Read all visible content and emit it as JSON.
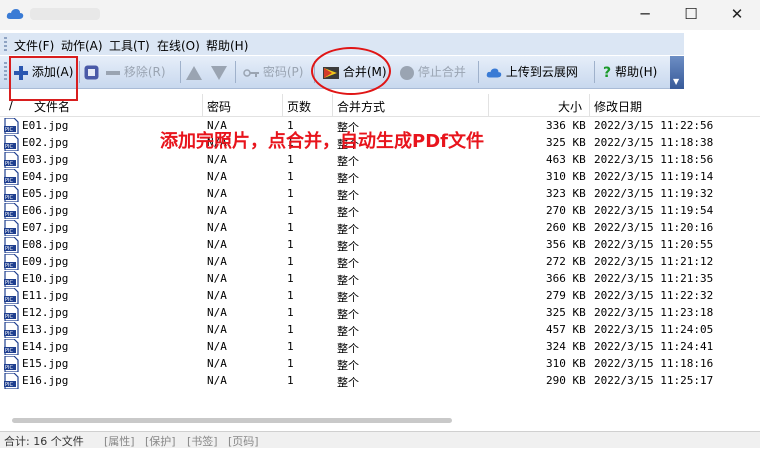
{
  "window": {
    "title": "",
    "minimize_glyph": "─",
    "maximize_glyph": "☐",
    "close_glyph": "✕"
  },
  "menu": [
    {
      "label": "文件(F)"
    },
    {
      "label": "动作(A)"
    },
    {
      "label": "工具(T)"
    },
    {
      "label": "在线(O)"
    },
    {
      "label": "帮助(H)"
    }
  ],
  "toolbar": {
    "add": "添加(A)",
    "remove": "移除(R)",
    "password": "密码(P)",
    "merge": "合并(M)",
    "stop_merge": "停止合并",
    "upload": "上传到云展网",
    "help": "帮助(H)",
    "overflow": "▼"
  },
  "columns": {
    "sort": "/",
    "name": "文件名",
    "password": "密码",
    "pages": "页数",
    "merge_mode": "合并方式",
    "size": "大小",
    "modified": "修改日期"
  },
  "files": [
    {
      "name": "E01.jpg",
      "password": "N/A",
      "pages": "1",
      "mode": "整个",
      "size": "336 KB",
      "date": "2022/3/15 11:22:56"
    },
    {
      "name": "E02.jpg",
      "password": "N/A",
      "pages": "1",
      "mode": "整个",
      "size": "325 KB",
      "date": "2022/3/15 11:18:38"
    },
    {
      "name": "E03.jpg",
      "password": "N/A",
      "pages": "1",
      "mode": "整个",
      "size": "463 KB",
      "date": "2022/3/15 11:18:56"
    },
    {
      "name": "E04.jpg",
      "password": "N/A",
      "pages": "1",
      "mode": "整个",
      "size": "310 KB",
      "date": "2022/3/15 11:19:14"
    },
    {
      "name": "E05.jpg",
      "password": "N/A",
      "pages": "1",
      "mode": "整个",
      "size": "323 KB",
      "date": "2022/3/15 11:19:32"
    },
    {
      "name": "E06.jpg",
      "password": "N/A",
      "pages": "1",
      "mode": "整个",
      "size": "270 KB",
      "date": "2022/3/15 11:19:54"
    },
    {
      "name": "E07.jpg",
      "password": "N/A",
      "pages": "1",
      "mode": "整个",
      "size": "260 KB",
      "date": "2022/3/15 11:20:16"
    },
    {
      "name": "E08.jpg",
      "password": "N/A",
      "pages": "1",
      "mode": "整个",
      "size": "356 KB",
      "date": "2022/3/15 11:20:55"
    },
    {
      "name": "E09.jpg",
      "password": "N/A",
      "pages": "1",
      "mode": "整个",
      "size": "272 KB",
      "date": "2022/3/15 11:21:12"
    },
    {
      "name": "E10.jpg",
      "password": "N/A",
      "pages": "1",
      "mode": "整个",
      "size": "366 KB",
      "date": "2022/3/15 11:21:35"
    },
    {
      "name": "E11.jpg",
      "password": "N/A",
      "pages": "1",
      "mode": "整个",
      "size": "279 KB",
      "date": "2022/3/15 11:22:32"
    },
    {
      "name": "E12.jpg",
      "password": "N/A",
      "pages": "1",
      "mode": "整个",
      "size": "325 KB",
      "date": "2022/3/15 11:23:18"
    },
    {
      "name": "E13.jpg",
      "password": "N/A",
      "pages": "1",
      "mode": "整个",
      "size": "457 KB",
      "date": "2022/3/15 11:24:05"
    },
    {
      "name": "E14.jpg",
      "password": "N/A",
      "pages": "1",
      "mode": "整个",
      "size": "324 KB",
      "date": "2022/3/15 11:24:41"
    },
    {
      "name": "E15.jpg",
      "password": "N/A",
      "pages": "1",
      "mode": "整个",
      "size": "310 KB",
      "date": "2022/3/15 11:18:16"
    },
    {
      "name": "E16.jpg",
      "password": "N/A",
      "pages": "1",
      "mode": "整个",
      "size": "290 KB",
      "date": "2022/3/15 11:25:17"
    }
  ],
  "annotation": {
    "text": "添加完照片，点合并，自动生成PDf文件",
    "color": "#e8141c"
  },
  "status": {
    "total": "合计: 16 个文件",
    "properties": "[属性]",
    "protect": "[保护]",
    "bookmarks": "[书签]",
    "pages": "[页码]"
  },
  "colors": {
    "accent": "#2f5fb3",
    "annotation_red": "#d81e1e"
  }
}
